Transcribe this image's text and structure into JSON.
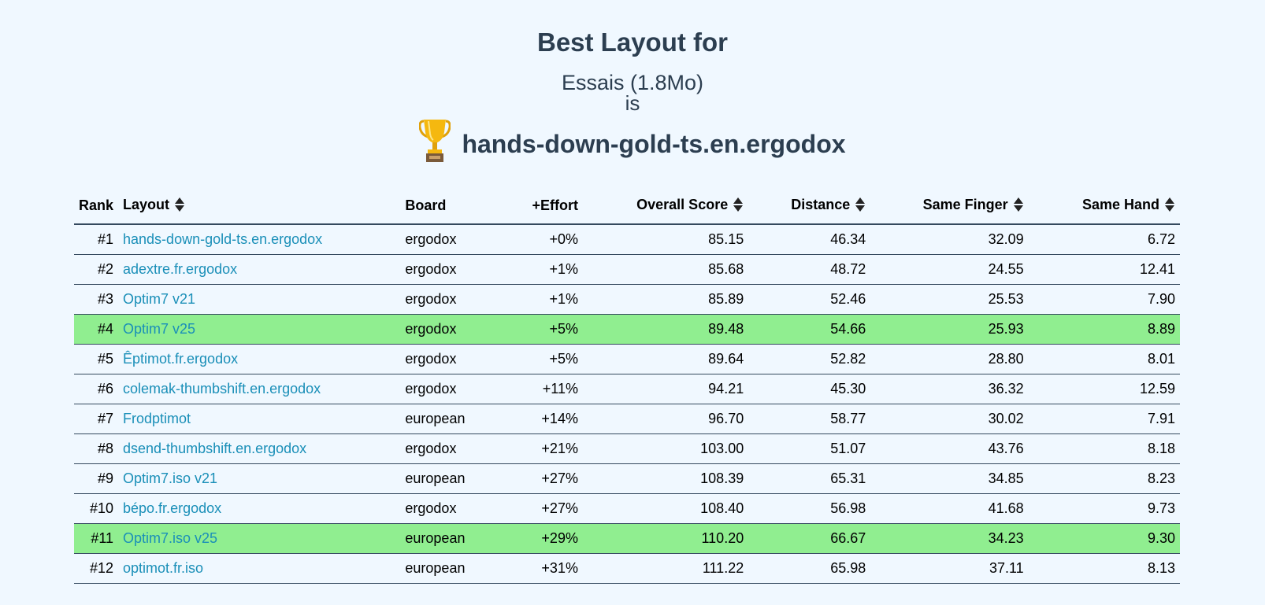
{
  "header": {
    "title": "Best Layout for",
    "corpus": "Essais (1.8Mo)",
    "is": "is",
    "winner": "hands-down-gold-ts.en.ergodox",
    "trophy_icon": "trophy-icon"
  },
  "table": {
    "columns": {
      "rank": "Rank",
      "layout": "Layout",
      "board": "Board",
      "effort": "+Effort",
      "overall": "Overall Score",
      "distance": "Distance",
      "same_finger": "Same Finger",
      "same_hand": "Same Hand"
    },
    "rows": [
      {
        "rank": "#1",
        "layout": "hands-down-gold-ts.en.ergodox",
        "board": "ergodox",
        "effort": "+0%",
        "overall": "85.15",
        "distance": "46.34",
        "same_finger": "32.09",
        "same_hand": "6.72",
        "highlight": false
      },
      {
        "rank": "#2",
        "layout": "adextre.fr.ergodox",
        "board": "ergodox",
        "effort": "+1%",
        "overall": "85.68",
        "distance": "48.72",
        "same_finger": "24.55",
        "same_hand": "12.41",
        "highlight": false
      },
      {
        "rank": "#3",
        "layout": "Optim7 v21",
        "board": "ergodox",
        "effort": "+1%",
        "overall": "85.89",
        "distance": "52.46",
        "same_finger": "25.53",
        "same_hand": "7.90",
        "highlight": false
      },
      {
        "rank": "#4",
        "layout": "Optim7 v25",
        "board": "ergodox",
        "effort": "+5%",
        "overall": "89.48",
        "distance": "54.66",
        "same_finger": "25.93",
        "same_hand": "8.89",
        "highlight": true
      },
      {
        "rank": "#5",
        "layout": "Êptimot.fr.ergodox",
        "board": "ergodox",
        "effort": "+5%",
        "overall": "89.64",
        "distance": "52.82",
        "same_finger": "28.80",
        "same_hand": "8.01",
        "highlight": false
      },
      {
        "rank": "#6",
        "layout": "colemak-thumbshift.en.ergodox",
        "board": "ergodox",
        "effort": "+11%",
        "overall": "94.21",
        "distance": "45.30",
        "same_finger": "36.32",
        "same_hand": "12.59",
        "highlight": false
      },
      {
        "rank": "#7",
        "layout": "Frodptimot",
        "board": "european",
        "effort": "+14%",
        "overall": "96.70",
        "distance": "58.77",
        "same_finger": "30.02",
        "same_hand": "7.91",
        "highlight": false
      },
      {
        "rank": "#8",
        "layout": "dsend-thumbshift.en.ergodox",
        "board": "ergodox",
        "effort": "+21%",
        "overall": "103.00",
        "distance": "51.07",
        "same_finger": "43.76",
        "same_hand": "8.18",
        "highlight": false
      },
      {
        "rank": "#9",
        "layout": "Optim7.iso v21",
        "board": "european",
        "effort": "+27%",
        "overall": "108.39",
        "distance": "65.31",
        "same_finger": "34.85",
        "same_hand": "8.23",
        "highlight": false
      },
      {
        "rank": "#10",
        "layout": "bépo.fr.ergodox",
        "board": "ergodox",
        "effort": "+27%",
        "overall": "108.40",
        "distance": "56.98",
        "same_finger": "41.68",
        "same_hand": "9.73",
        "highlight": false
      },
      {
        "rank": "#11",
        "layout": "Optim7.iso v25",
        "board": "european",
        "effort": "+29%",
        "overall": "110.20",
        "distance": "66.67",
        "same_finger": "34.23",
        "same_hand": "9.30",
        "highlight": true
      },
      {
        "rank": "#12",
        "layout": "optimot.fr.iso",
        "board": "european",
        "effort": "+31%",
        "overall": "111.22",
        "distance": "65.98",
        "same_finger": "37.11",
        "same_hand": "8.13",
        "highlight": false
      }
    ]
  },
  "colors": {
    "background": "#f0f8ff",
    "highlight": "#90ee90",
    "link": "#1a8fb8",
    "heading": "#2c3e50"
  }
}
